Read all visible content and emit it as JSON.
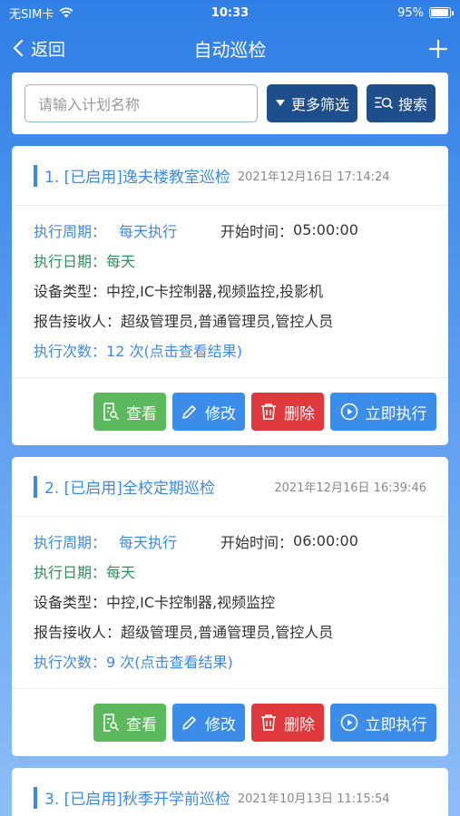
{
  "status_bar": {
    "carrier": "无SIM卡",
    "time": "10:33",
    "battery": "95%",
    "battery_level": 0.95
  },
  "nav": {
    "back_label": "返回",
    "title": "自动巡检",
    "add_icon": "plus-icon"
  },
  "search": {
    "placeholder": "请输入计划名称",
    "filter_label": "更多筛选",
    "search_label": "搜索"
  },
  "labels": {
    "cycle": "执行周期：",
    "start_time": "开始时间：",
    "date": "执行日期：",
    "device_type": "设备类型：",
    "receivers": "报告接收人：",
    "count": "执行次数："
  },
  "actions": {
    "view": "查看",
    "edit": "修改",
    "delete": "删除",
    "run": "立即执行"
  },
  "plans": [
    {
      "title": "1. [已启用]逸夫楼教室巡检",
      "time": "2021年12月16日 17:14:24",
      "cycle": "每天执行",
      "start_time": "05:00:00",
      "date": "每天",
      "device_type": "中控,IC卡控制器,视频监控,投影机",
      "receivers": "超级管理员,普通管理员,管控人员",
      "count": "12 次(点击查看结果)"
    },
    {
      "title": "2. [已启用]全校定期巡检",
      "time": "2021年12月16日 16:39:46",
      "cycle": "每天执行",
      "start_time": "06:00:00",
      "date": "每天",
      "device_type": "中控,IC卡控制器,视频监控",
      "receivers": "超级管理员,普通管理员,管控人员",
      "count": "9 次(点击查看结果)"
    },
    {
      "title": "3. [已启用]秋季开学前巡检",
      "time": "2021年10月13日 11:15:54"
    }
  ]
}
